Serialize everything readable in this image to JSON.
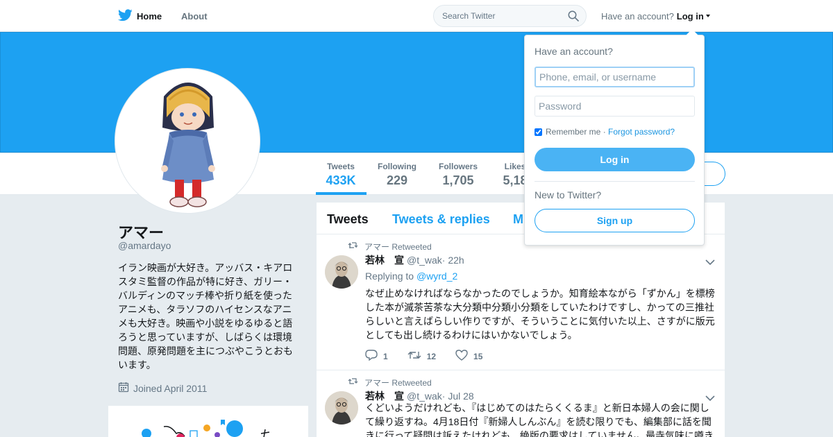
{
  "topbar": {
    "home_label": "Home",
    "about_label": "About",
    "search_placeholder": "Search Twitter",
    "have_account_text": "Have an account?",
    "login_label": "Log in"
  },
  "colors": {
    "accent": "#1da1f2",
    "banner": "#1da1f2",
    "page_background": "#e6ecf0"
  },
  "icons": {
    "brand": "twitter-bird-icon",
    "search": "search-icon",
    "retweet": "retweet-icon",
    "reply": "reply-icon",
    "like": "heart-icon",
    "calendar": "calendar-icon",
    "more": "chevron-down-icon"
  },
  "stats": {
    "tweets": {
      "label": "Tweets",
      "value": "433K"
    },
    "following": {
      "label": "Following",
      "value": "229"
    },
    "followers": {
      "label": "Followers",
      "value": "1,705"
    },
    "likes": {
      "label": "Likes",
      "value": "5,18"
    }
  },
  "profile": {
    "name": "アマー",
    "handle": "@amardayo",
    "bio": "イラン映画が大好き。アッバス・キアロスタミ監督の作品が特に好き、ガリー・バルディンのマッチ棒や折り紙を使ったアニメも、タラソフのハイセンスなアニメも大好き。映画や小説をゆるゆると語ろうと思っていますが、しばらくは環境問題、原発問題を主につぶやこうとおもいます。",
    "joined": "Joined April 2011"
  },
  "timeline": {
    "tabs": [
      "Tweets",
      "Tweets & replies",
      "M"
    ],
    "tweets": [
      {
        "retweeted_by": "アマー Retweeted",
        "name": "若林　宣",
        "handle": "@t_wak",
        "time": "· 22h",
        "replying_label": "Replying to",
        "replying_to": "@wyrd_2",
        "text": "なぜ止めなければならなかったのでしょうか。知育絵本ながら「ずかん」を標榜した本が滅茶苦茶な大分類中分類小分類をしていたわけですし、かっての三推社らしいと言えばらしい作りですが、そういうことに気付いた以上、さすがに版元としても出し続けるわけにはいかないでしょう。",
        "replies": "1",
        "retweets": "12",
        "likes": "15"
      },
      {
        "retweeted_by": "アマー Retweeted",
        "name": "若林　宣",
        "handle": "@t_wak",
        "time": "· Jul 28",
        "text": "くどいようだけれども、『はじめてのはたらくくるま』と新日本婦人の会に関して繰り返すね。4月18日付『新婦人しんぶん』を読む限りでも、編集部に話を聞きに行って疑問は訴えたけれども、絶版の要求はしていません。最寺気味に噂き"
      }
    ]
  },
  "login_dropdown": {
    "title": "Have an account?",
    "username_placeholder": "Phone, email, or username",
    "password_placeholder": "Password",
    "remember_label": "Remember me ·",
    "forgot_label": "Forgot password?",
    "login_button": "Log in",
    "new_label": "New to Twitter?",
    "signup_button": "Sign up"
  }
}
